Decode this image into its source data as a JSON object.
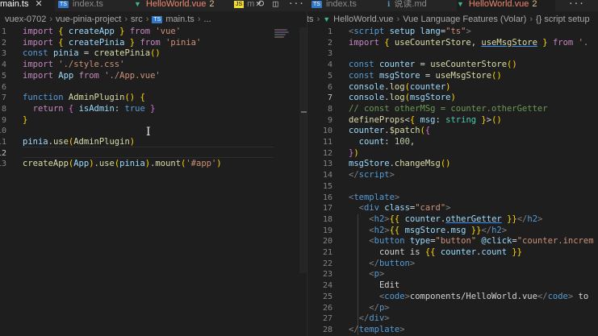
{
  "tabs": [
    {
      "label": "main.ts",
      "active": true,
      "type": "ts"
    },
    {
      "label": "index.ts",
      "type": "ts"
    },
    {
      "label": "HelloWorld.vue",
      "count": "2",
      "type": "vue",
      "error": true
    },
    {
      "label": "m",
      "type": "js"
    },
    {
      "label": "index.ts",
      "type": "ts"
    },
    {
      "label": "说读.md",
      "type": "md"
    },
    {
      "label": "HelloWorld.vue",
      "count": "2",
      "type": "vue",
      "error": true
    }
  ],
  "left_breadcrumb": {
    "parts": [
      "vuex-0702",
      "vue-pinia-project",
      "src"
    ],
    "file": "main.ts",
    "trail": "..."
  },
  "right_breadcrumb": {
    "lead": "ts",
    "file": "HelloWorld.vue",
    "parts": [
      "Vue Language Features (Volar)"
    ],
    "tail": "{} script setup"
  },
  "left_editor": {
    "current_line": 12,
    "lines": [
      {
        "n": "1",
        "html": "<span class='k'>import</span> <span class='br'>{</span> <span class='v'>createApp</span> <span class='br'>}</span> <span class='k'>from</span> <span class='s'>'vue'</span>"
      },
      {
        "n": "2",
        "html": "<span class='k'>import</span> <span class='br'>{</span> <span class='v'>createPinia</span> <span class='br'>}</span> <span class='k'>from</span> <span class='s'>'pinia'</span>"
      },
      {
        "n": "3",
        "html": "<span class='kb'>const</span> <span class='v'>pinia</span> <span class='p'>=</span> <span class='f'>createPinia</span><span class='br'>()</span>"
      },
      {
        "n": "4",
        "html": "<span class='k'>import</span> <span class='s'>'./style.css'</span>"
      },
      {
        "n": "5",
        "html": "<span class='k'>import</span> <span class='v'>App</span> <span class='k'>from</span> <span class='s'>'./App.vue'</span>"
      },
      {
        "n": "6",
        "html": ""
      },
      {
        "n": "7",
        "html": "<span class='kb'>function</span> <span class='f'>AdminPlugin</span><span class='br'>()</span> <span class='br'>{</span>"
      },
      {
        "n": "8",
        "html": "  <span class='k'>return</span> <span class='br2'>{</span> <span class='v'>isAdmin</span><span class='p'>:</span> <span class='kb'>true</span> <span class='br2'>}</span>"
      },
      {
        "n": "9",
        "html": "<span class='br'>}</span>"
      },
      {
        "n": "10",
        "html": ""
      },
      {
        "n": "11",
        "html": "<span class='v'>pinia</span><span class='p'>.</span><span class='f'>use</span><span class='br'>(</span><span class='f'>AdminPlugin</span><span class='br'>)</span>"
      },
      {
        "n": "12",
        "html": ""
      },
      {
        "n": "13",
        "html": "<span class='f'>createApp</span><span class='br'>(</span><span class='v'>App</span><span class='br'>)</span><span class='p'>.</span><span class='f'>use</span><span class='br'>(</span><span class='v'>pinia</span><span class='br'>)</span><span class='p'>.</span><span class='f'>mount</span><span class='br'>(</span><span class='s'>'#app'</span><span class='br'>)</span>"
      }
    ]
  },
  "right_editor": {
    "current_line": 7,
    "lines": [
      {
        "n": "1",
        "html": "<span class='tgb'>&lt;</span><span class='tg'>script</span> <span class='at'>setup</span> <span class='at'>lang</span><span class='p'>=</span><span class='s'>\"ts\"</span><span class='tgb'>&gt;</span>"
      },
      {
        "n": "2",
        "html": "<span class='k'>import</span> <span class='br'>{</span> <span class='f'>useCounterStore</span><span class='p'>,</span> <span class='f ul'>useMsgStore</span> <span class='br'>}</span> <span class='k'>from</span> <span class='s'>'.</span>"
      },
      {
        "n": "3",
        "html": ""
      },
      {
        "n": "4",
        "html": "<span class='kb'>const</span> <span class='v'>counter</span> <span class='p'>=</span> <span class='f'>useCounterStore</span><span class='br'>()</span>"
      },
      {
        "n": "5",
        "html": "<span class='kb'>const</span> <span class='v'>msgStore</span> <span class='p'>=</span> <span class='f'>useMsgStore</span><span class='br'>()</span>"
      },
      {
        "n": "6",
        "html": "<span class='v'>console</span><span class='p'>.</span><span class='f'>log</span><span class='br'>(</span><span class='v'>counter</span><span class='br'>)</span>"
      },
      {
        "n": "7",
        "html": "<span class='v'>console</span><span class='p'>.</span><span class='f'>log</span><span class='br'>(</span><span class='v'>msgStore</span><span class='br'>)</span>"
      },
      {
        "n": "8",
        "html": "<span class='c'>// const otherMSg = counter.otherGetter</span>"
      },
      {
        "n": "9",
        "html": "<span class='f'>defineProps</span><span class='p'>&lt;</span><span class='br'>{</span> <span class='v'>msg</span><span class='p'>:</span> <span class='t'>string</span> <span class='br'>}</span><span class='p'>&gt;</span><span class='br'>()</span>"
      },
      {
        "n": "10",
        "html": "<span class='v'>counter</span><span class='p'>.</span><span class='f'>$patch</span><span class='br'>(</span><span class='br2'>{</span>"
      },
      {
        "n": "11",
        "html": "  <span class='v'>count</span><span class='p'>:</span> <span class='n'>100</span><span class='p'>,</span>"
      },
      {
        "n": "12",
        "html": "<span class='br2'>}</span><span class='br'>)</span>"
      },
      {
        "n": "13",
        "html": "<span class='v'>msgStore</span><span class='p'>.</span><span class='f'>changeMsg</span><span class='br'>()</span>"
      },
      {
        "n": "14",
        "html": "<span class='tgb'>&lt;/</span><span class='tg'>script</span><span class='tgb'>&gt;</span>"
      },
      {
        "n": "15",
        "html": ""
      },
      {
        "n": "16",
        "html": "<span class='tgb'>&lt;</span><span class='tg'>template</span><span class='tgb'>&gt;</span>"
      },
      {
        "n": "17",
        "html": "  <span class='tgb'>&lt;</span><span class='tg'>div</span> <span class='at'>class</span><span class='p'>=</span><span class='s'>\"card\"</span><span class='tgb'>&gt;</span>"
      },
      {
        "n": "18",
        "html": "    <span class='tgb'>&lt;</span><span class='tg'>h2</span><span class='tgb'>&gt;</span><span class='br'>{{</span> <span class='v'>counter</span><span class='p'>.</span><span class='v ul'>otherGetter</span> <span class='br'>}}</span><span class='tgb'>&lt;/</span><span class='tg'>h2</span><span class='tgb'>&gt;</span>"
      },
      {
        "n": "19",
        "html": "    <span class='tgb'>&lt;</span><span class='tg'>h2</span><span class='tgb'>&gt;</span><span class='br'>{{</span> <span class='v'>msgStore</span><span class='p'>.</span><span class='v'>msg</span> <span class='br'>}}</span><span class='tgb'>&lt;/</span><span class='tg'>h2</span><span class='tgb'>&gt;</span>"
      },
      {
        "n": "20",
        "html": "    <span class='tgb'>&lt;</span><span class='tg'>button</span> <span class='at'>type</span><span class='p'>=</span><span class='s'>\"button\"</span> <span class='at'>@click</span><span class='p'>=</span><span class='s'>\"counter.increm</span>"
      },
      {
        "n": "21",
        "html": "      <span class='p'>count is</span> <span class='br'>{{</span> <span class='v'>counter</span><span class='p'>.</span><span class='v'>count</span> <span class='br'>}}</span>"
      },
      {
        "n": "22",
        "html": "    <span class='tgb'>&lt;/</span><span class='tg'>button</span><span class='tgb'>&gt;</span>"
      },
      {
        "n": "23",
        "html": "    <span class='tgb'>&lt;</span><span class='tg'>p</span><span class='tgb'>&gt;</span>"
      },
      {
        "n": "24",
        "html": "      <span class='p'>Edit</span>"
      },
      {
        "n": "25",
        "html": "      <span class='tgb'>&lt;</span><span class='tg'>code</span><span class='tgb'>&gt;</span><span class='p'>components/HelloWorld.vue</span><span class='tgb'>&lt;/</span><span class='tg'>code</span><span class='tgb'>&gt;</span> <span class='p'>to</span>"
      },
      {
        "n": "26",
        "html": "    <span class='tgb'>&lt;/</span><span class='tg'>p</span><span class='tgb'>&gt;</span>"
      },
      {
        "n": "27",
        "html": "  <span class='tgb'>&lt;/</span><span class='tg'>div</span><span class='tgb'>&gt;</span>"
      },
      {
        "n": "28",
        "html": "<span class='tgb'>&lt;/</span><span class='tg'>template</span><span class='tgb'>&gt;</span>"
      }
    ]
  },
  "toolbar_icons": [
    "close-icon",
    "history-icon",
    "split-editor-icon",
    "more-icon"
  ]
}
